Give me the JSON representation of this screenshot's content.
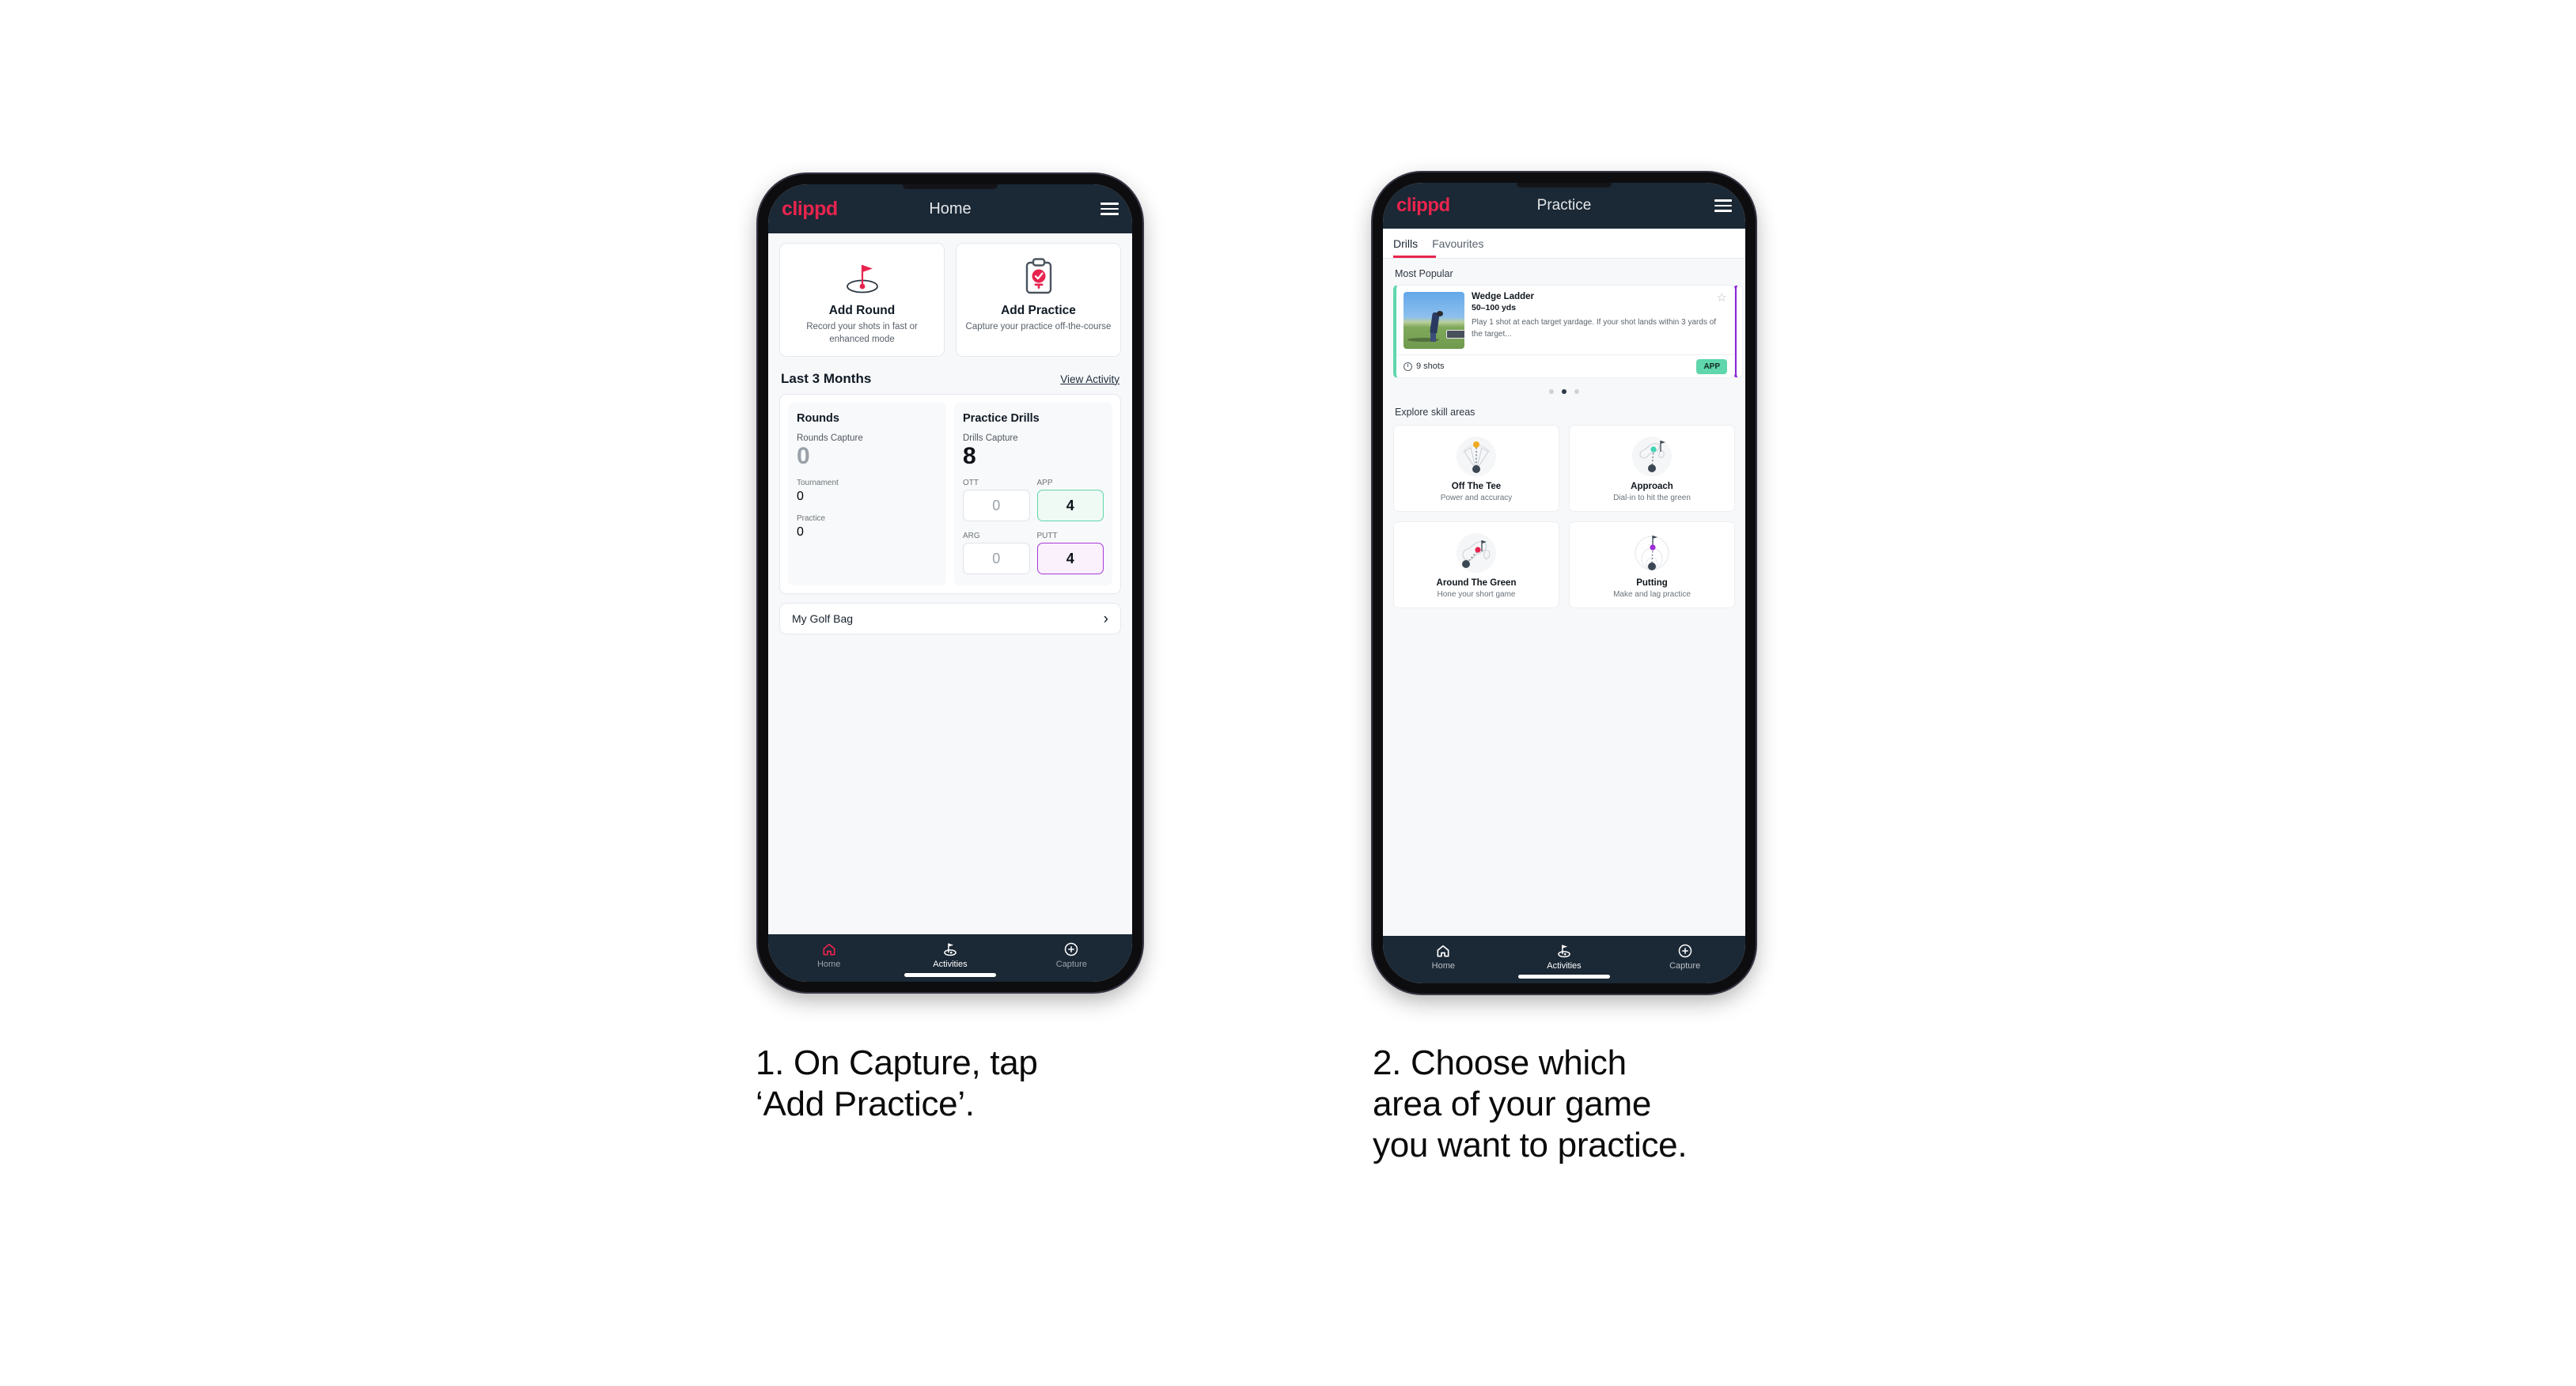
{
  "brand": {
    "name": "clippd",
    "accent": "#e8244e",
    "header_bg": "#1b2835"
  },
  "phone1": {
    "header": {
      "logo": "clippd",
      "title": "Home",
      "menu_icon": "hamburger-icon"
    },
    "quick_actions": [
      {
        "icon": "golf-flag-hole-icon",
        "title": "Add Round",
        "subtitle": "Record your shots in fast or enhanced mode"
      },
      {
        "icon": "clipboard-check-icon",
        "title": "Add Practice",
        "subtitle": "Capture your practice off-the-course"
      }
    ],
    "section": {
      "title": "Last 3 Months",
      "link": "View Activity"
    },
    "stats": {
      "rounds": {
        "heading": "Rounds",
        "capture_label": "Rounds Capture",
        "capture_value": "0",
        "items": [
          {
            "label": "Tournament",
            "value": "0",
            "highlight": "none"
          },
          {
            "label": "Practice",
            "value": "0",
            "highlight": "none"
          }
        ]
      },
      "drills": {
        "heading": "Practice Drills",
        "capture_label": "Drills Capture",
        "capture_value": "8",
        "items": [
          {
            "label": "OTT",
            "value": "0",
            "highlight": "none"
          },
          {
            "label": "APP",
            "value": "4",
            "highlight": "green"
          },
          {
            "label": "ARG",
            "value": "0",
            "highlight": "none"
          },
          {
            "label": "PUTT",
            "value": "4",
            "highlight": "purple"
          }
        ]
      }
    },
    "golf_bag": {
      "label": "My Golf Bag",
      "chevron": "chevron-right-icon"
    },
    "bottom_nav": [
      {
        "icon": "home-icon",
        "label": "Home",
        "state": "accent-icon"
      },
      {
        "icon": "golf-flag-icon",
        "label": "Activities",
        "state": "active"
      },
      {
        "icon": "plus-circle-icon",
        "label": "Capture",
        "state": "default"
      }
    ]
  },
  "phone2": {
    "header": {
      "logo": "clippd",
      "title": "Practice",
      "menu_icon": "hamburger-icon"
    },
    "tabs": [
      {
        "label": "Drills",
        "active": true
      },
      {
        "label": "Favourites",
        "active": false
      }
    ],
    "most_popular_label": "Most Popular",
    "drill_card": {
      "title": "Wedge Ladder",
      "yardage": "50–100 yds",
      "description": "Play 1 shot at each target yardage. If your shot lands within 3 yards of the target...",
      "shots": "9 shots",
      "tag": "APP",
      "favourite_icon": "star-outline-icon",
      "accent_left": "#5fd6ac",
      "next_card_accent": "#8e24d6"
    },
    "carousel_dots": {
      "count": 3,
      "active_index": 1
    },
    "explore_label": "Explore skill areas",
    "skill_areas": [
      {
        "icon": "off-the-tee-icon",
        "title": "Off The Tee",
        "subtitle": "Power and accuracy",
        "dot_color": "#f0ab21"
      },
      {
        "icon": "approach-icon",
        "title": "Approach",
        "subtitle": "Dial-in to hit the green",
        "dot_color": "#3fd4b4"
      },
      {
        "icon": "around-the-green-icon",
        "title": "Around The Green",
        "subtitle": "Hone your short game",
        "dot_color": "#e8244e"
      },
      {
        "icon": "putting-icon",
        "title": "Putting",
        "subtitle": "Make and lag practice",
        "dot_color": "#9b2fd6"
      }
    ],
    "bottom_nav": [
      {
        "icon": "home-icon",
        "label": "Home",
        "state": "default"
      },
      {
        "icon": "golf-flag-icon",
        "label": "Activities",
        "state": "active"
      },
      {
        "icon": "plus-circle-icon",
        "label": "Capture",
        "state": "default"
      }
    ]
  },
  "captions": {
    "step1": "1. On Capture, tap\n‘Add Practice’.",
    "step2": "2. Choose which\narea of your game\nyou want to practice."
  }
}
